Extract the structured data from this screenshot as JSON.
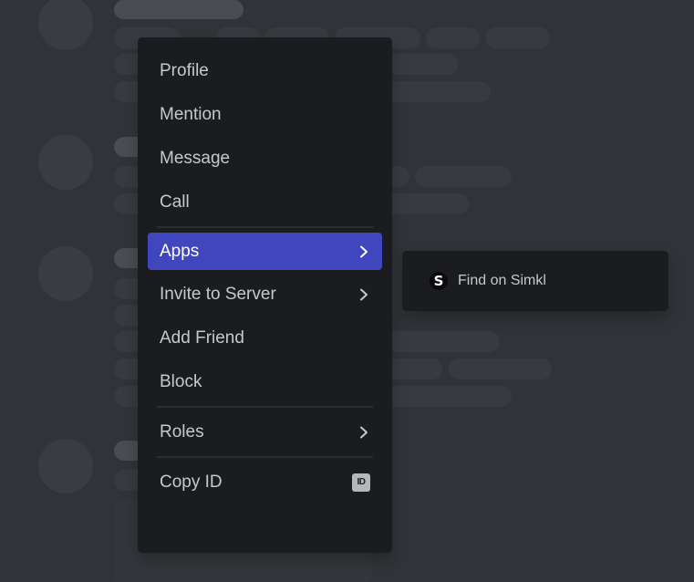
{
  "context_menu": {
    "groups": [
      [
        {
          "label": "Profile"
        },
        {
          "label": "Mention"
        },
        {
          "label": "Message"
        },
        {
          "label": "Call"
        }
      ],
      [
        {
          "label": "Apps",
          "has_submenu": true,
          "active": true
        },
        {
          "label": "Invite to Server",
          "has_submenu": true
        },
        {
          "label": "Add Friend"
        },
        {
          "label": "Block"
        }
      ],
      [
        {
          "label": "Roles",
          "has_submenu": true
        }
      ],
      [
        {
          "label": "Copy ID",
          "badge": "ID"
        }
      ]
    ],
    "active_color": "#4046bd"
  },
  "apps_submenu": {
    "items": [
      {
        "label": "Find on Simkl",
        "icon": "simkl-icon",
        "icon_glyph": "S"
      }
    ]
  }
}
